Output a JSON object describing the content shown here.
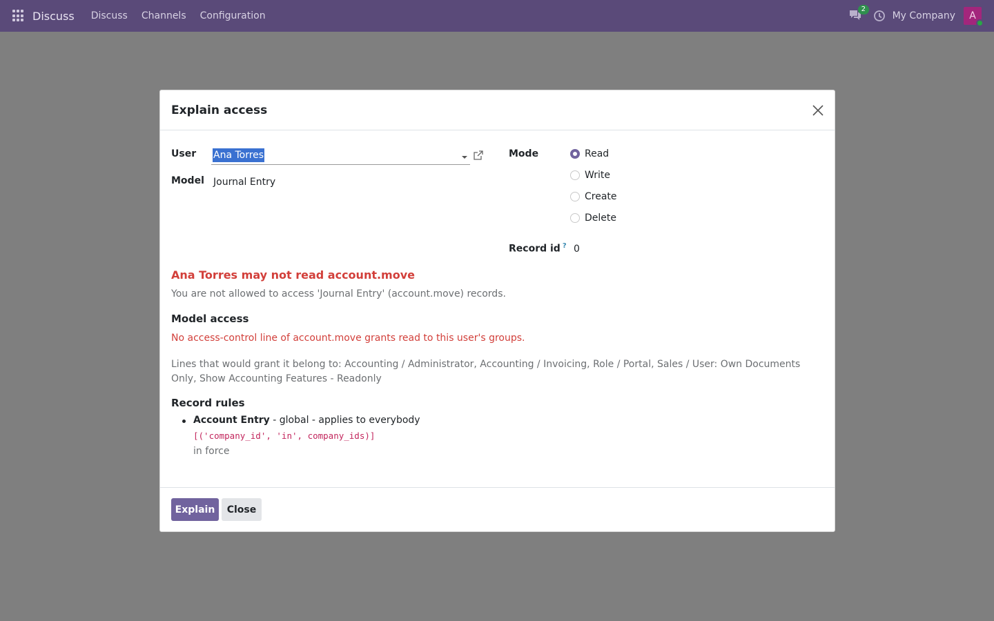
{
  "navbar": {
    "brand": "Discuss",
    "menu": [
      "Discuss",
      "Channels",
      "Configuration"
    ],
    "chat_count": "2",
    "company": "My Company",
    "avatar_letter": "A"
  },
  "dialog": {
    "title": "Explain access",
    "user_label": "User",
    "user_value": "Ana Torres",
    "model_label": "Model",
    "model_value": "Journal Entry",
    "mode_label": "Mode",
    "modes": [
      {
        "label": "Read",
        "checked": true
      },
      {
        "label": "Write",
        "checked": false
      },
      {
        "label": "Create",
        "checked": false
      },
      {
        "label": "Delete",
        "checked": false
      }
    ],
    "record_label": "Record id",
    "record_help": "?",
    "record_value": "0",
    "result_title": "Ana Torres may not read account.move",
    "result_subtitle": "You are not allowed to access 'Journal Entry' (account.move) records.",
    "model_access_title": "Model access",
    "model_access_error": "No access-control line of account.move grants read to this user's groups.",
    "grant_text": "Lines that would grant it belong to: Accounting / Administrator, Accounting / Invoicing, Role / Portal, Sales / User: Own Documents Only, Show Accounting Features - Readonly",
    "record_rules_title": "Record rules",
    "rules": [
      {
        "name": "Account Entry",
        "scope": " - global - applies to everybody",
        "domain": "[('company_id', 'in', company_ids)]",
        "status": "in force"
      }
    ],
    "explain_button": "Explain",
    "close_button": "Close"
  },
  "colors": {
    "navbar": "#5a4a79",
    "primary": "#71639e",
    "danger": "#d23f3a",
    "code": "#c2255c"
  }
}
